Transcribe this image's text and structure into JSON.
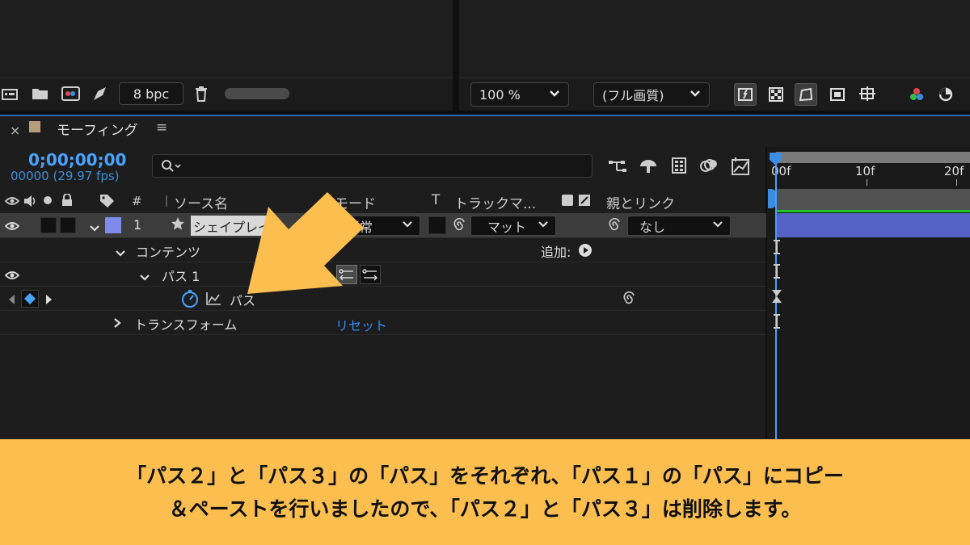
{
  "toolbar_left": {
    "bpc_label": "8 bpc"
  },
  "toolbar_right": {
    "zoom_value": "100 %",
    "quality_value": "(フル画質)"
  },
  "comp": {
    "name": "モーフィング",
    "timecode": "0;00;00;00",
    "frame_fps": "00000 (29.97 fps)"
  },
  "search": {
    "placeholder": ""
  },
  "columns": {
    "number": "#",
    "source_name": "ソース名",
    "mode": "モード",
    "t": "T",
    "track_matte": "トラックマ...",
    "parent_link": "親とリンク"
  },
  "layer": {
    "index": "1",
    "name": "シェイプレイ",
    "mode": "通常",
    "matte": "マット",
    "parent": "なし"
  },
  "rows": {
    "contents": "コンテンツ",
    "add_label": "追加:",
    "path_group": "パス 1",
    "path_prop": "パス",
    "transform": "トランスフォーム",
    "reset": "リセット"
  },
  "timeline": {
    "tick_0": "00f",
    "tick_10": "10f",
    "tick_20": "20f"
  },
  "caption": {
    "line1": "「パス２」と「パス３」の「パス」をそれぞれ、「パス１」の「パス」にコピー",
    "line2": "＆ペーストを行いましたので、「パス２」と「パス３」は削除します。"
  },
  "colors": {
    "accent_blue": "#4aa3ff",
    "caption_bg": "#fcbf4f",
    "arrow": "#fcbf4f",
    "layer_label": "#7f8bea",
    "timeline_layer": "#5561c4"
  },
  "icons": [
    "render-queue-icon",
    "folder-icon",
    "composition-icon",
    "pen-icon",
    "trash-icon",
    "chevron-down-icon",
    "fast-preview-icon",
    "transparency-grid-icon",
    "mask-path-icon",
    "region-icon",
    "guides-icon",
    "rgb-channel-icon",
    "reset-exposure-icon",
    "eye-icon",
    "audio-icon",
    "solo-icon",
    "lock-icon",
    "label-icon",
    "stopwatch-icon",
    "graph-icon",
    "spiral-link-icon",
    "keyframe-diamond-icon",
    "star-icon"
  ]
}
